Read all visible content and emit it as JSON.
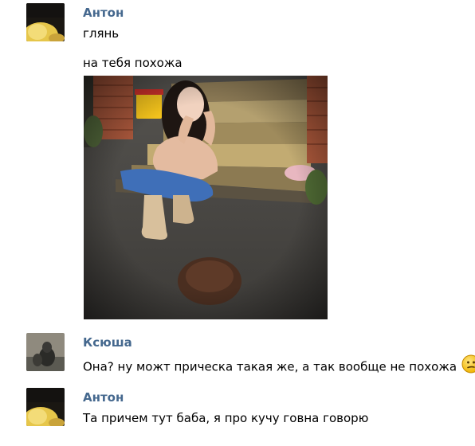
{
  "messages": [
    {
      "author": "Антон",
      "avatar_icon": "user-avatar-anton-icon",
      "lines": [
        "глянь",
        "на тебя похожа"
      ],
      "attachment": "photo"
    },
    {
      "author": "Ксюша",
      "avatar_icon": "user-avatar-ksyusha-icon",
      "lines": [
        "Она? ну можт прическа такая же, а так вообще не похожа"
      ],
      "emoji": "confused-face-icon"
    },
    {
      "author": "Антон",
      "avatar_icon": "user-avatar-anton-icon",
      "lines": [
        "Та причем тут баба, я про кучу говна говорю"
      ]
    }
  ],
  "colors": {
    "author_name": "#45688e",
    "text": "#000000",
    "background": "#ffffff"
  }
}
